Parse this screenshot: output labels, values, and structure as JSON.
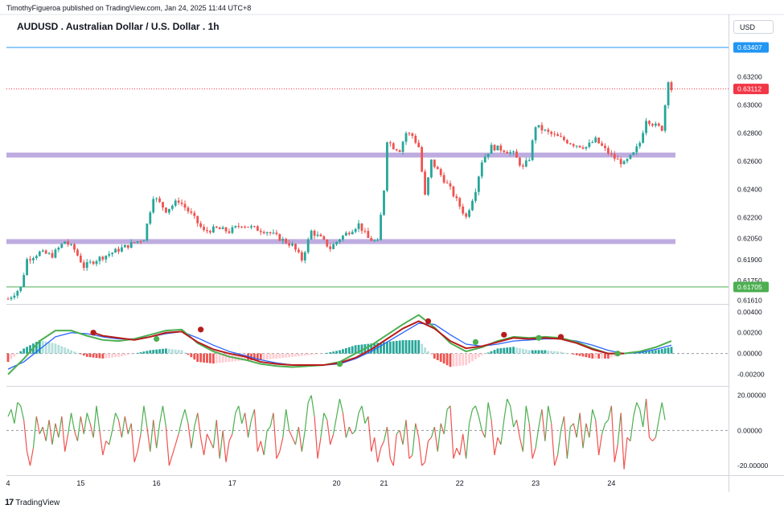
{
  "header": {
    "publisher": "TimothyFigueroa published on TradingView.com, Jan 24, 2025 11:44 UTC+8",
    "title": "AUDUSD . Australian Dollar / U.S. Dollar . 1h",
    "currency": "USD"
  },
  "footer": {
    "logo": "17",
    "brand": "TradingView"
  },
  "colors": {
    "up": "#26a69a",
    "down": "#ef5350",
    "zone": "#b39ddb",
    "blue_line": "#2196f3",
    "green_line": "#4caf50",
    "last_price": "#f23645",
    "macd_fast": "#4caf50",
    "macd_signal": "#2962ff",
    "macd_dark": "#b71c1c",
    "osc_up": "#4caf50",
    "osc_down": "#ef5350"
  },
  "chart_data": [
    {
      "type": "candlestick",
      "title": "AUDUSD . Australian Dollar / U.S. Dollar . 1h",
      "y_ticks": [
        "0.63200",
        "0.63000",
        "0.62800",
        "0.62600",
        "0.62400",
        "0.62200",
        "0.62050",
        "0.61900",
        "0.61750",
        "0.61610"
      ],
      "ylim": [
        0.6159,
        0.6347
      ],
      "x_ticks": [
        "4",
        "15",
        "16",
        "17",
        "20",
        "21",
        "22",
        "23",
        "24"
      ],
      "price_tags": [
        {
          "label": "0.63407",
          "value": 0.63407,
          "color": "#2196f3"
        },
        {
          "label": "0.63112",
          "value": 0.63112,
          "color": "#f23645"
        },
        {
          "label": "0.61705",
          "value": 0.61705,
          "color": "#4caf50"
        }
      ],
      "zones": [
        {
          "from": 0.62625,
          "to": 0.6266
        },
        {
          "from": 0.6201,
          "to": 0.62045
        }
      ],
      "close_path": [
        [
          0,
          0.6162
        ],
        [
          4,
          0.617
        ],
        [
          6,
          0.619
        ],
        [
          10,
          0.6195
        ],
        [
          14,
          0.6193
        ],
        [
          18,
          0.6203
        ],
        [
          21,
          0.6197
        ],
        [
          24,
          0.6185
        ],
        [
          28,
          0.619
        ],
        [
          33,
          0.6195
        ],
        [
          38,
          0.62
        ],
        [
          43,
          0.6205
        ],
        [
          46,
          0.6235
        ],
        [
          50,
          0.6225
        ],
        [
          54,
          0.6232
        ],
        [
          58,
          0.6222
        ],
        [
          62,
          0.621
        ],
        [
          66,
          0.6212
        ],
        [
          70,
          0.621
        ],
        [
          74,
          0.6215
        ],
        [
          78,
          0.6212
        ],
        [
          82,
          0.621
        ],
        [
          86,
          0.6205
        ],
        [
          90,
          0.62
        ],
        [
          93,
          0.619
        ],
        [
          96,
          0.621
        ],
        [
          99,
          0.6205
        ],
        [
          102,
          0.6198
        ],
        [
          105,
          0.6205
        ],
        [
          108,
          0.621
        ],
        [
          111,
          0.6215
        ],
        [
          114,
          0.6205
        ],
        [
          117,
          0.6202
        ],
        [
          119,
          0.624
        ],
        [
          120,
          0.6275
        ],
        [
          122,
          0.627
        ],
        [
          124,
          0.6268
        ],
        [
          126,
          0.628
        ],
        [
          128,
          0.6278
        ],
        [
          130,
          0.627
        ],
        [
          132,
          0.6235
        ],
        [
          134,
          0.626
        ],
        [
          137,
          0.625
        ],
        [
          140,
          0.624
        ],
        [
          142,
          0.6232
        ],
        [
          145,
          0.622
        ],
        [
          148,
          0.624
        ],
        [
          150,
          0.626
        ],
        [
          153,
          0.627
        ],
        [
          157,
          0.6268
        ],
        [
          160,
          0.6265
        ],
        [
          163,
          0.6255
        ],
        [
          165,
          0.6262
        ],
        [
          167,
          0.6285
        ],
        [
          171,
          0.628
        ],
        [
          175,
          0.6276
        ],
        [
          179,
          0.6272
        ],
        [
          183,
          0.627
        ],
        [
          186,
          0.6275
        ],
        [
          189,
          0.6268
        ],
        [
          192,
          0.6262
        ],
        [
          195,
          0.6258
        ],
        [
          198,
          0.6265
        ],
        [
          200,
          0.6273
        ],
        [
          202,
          0.629
        ],
        [
          205,
          0.6285
        ],
        [
          207,
          0.6283
        ],
        [
          208,
          0.63
        ],
        [
          209,
          0.6318
        ],
        [
          210,
          0.6311
        ]
      ]
    },
    {
      "type": "line",
      "name": "MACD panel",
      "y_ticks": [
        "0.00400",
        "0.00200",
        "0.00000",
        "-0.00200"
      ],
      "ylim": [
        -0.0028,
        0.0046
      ],
      "series": [
        {
          "key": "green",
          "x": [
            0,
            5,
            10,
            15,
            20,
            25,
            30,
            35,
            40,
            45,
            50,
            55,
            60,
            65,
            70,
            75,
            80,
            85,
            90,
            95,
            100,
            105,
            110,
            115,
            120,
            125,
            130,
            135,
            140,
            145,
            150,
            155,
            160,
            165,
            170,
            175,
            180,
            185,
            190,
            195,
            200,
            205,
            210
          ],
          "values": [
            -0.002,
            -0.0005,
            0.0012,
            0.0022,
            0.0022,
            0.0017,
            0.0013,
            0.0012,
            0.0014,
            0.0018,
            0.0022,
            0.0023,
            0.001,
            0.0002,
            -0.0003,
            -0.0006,
            -0.001,
            -0.0012,
            -0.0013,
            -0.0012,
            -0.0011,
            -0.0008,
            0.0,
            0.0008,
            0.0018,
            0.0028,
            0.0037,
            0.0025,
            0.001,
            0.0002,
            0.0006,
            0.0012,
            0.0016,
            0.0015,
            0.0016,
            0.0015,
            0.0011,
            0.0005,
            0.0,
            0.0,
            0.0002,
            0.0006,
            0.0012
          ]
        },
        {
          "key": "blue",
          "x": [
            0,
            5,
            10,
            15,
            20,
            25,
            30,
            35,
            40,
            45,
            50,
            55,
            60,
            65,
            70,
            75,
            80,
            85,
            90,
            95,
            100,
            105,
            110,
            115,
            120,
            125,
            130,
            135,
            140,
            145,
            150,
            155,
            160,
            165,
            170,
            175,
            180,
            185,
            190,
            195,
            200,
            205,
            210
          ],
          "values": [
            -0.0015,
            -0.0008,
            0.0004,
            0.0016,
            0.002,
            0.0019,
            0.0016,
            0.0014,
            0.0014,
            0.0016,
            0.0019,
            0.0021,
            0.0015,
            0.0008,
            0.0002,
            -0.0002,
            -0.0006,
            -0.0009,
            -0.0011,
            -0.0011,
            -0.0011,
            -0.001,
            -0.0005,
            0.0002,
            0.0011,
            0.002,
            0.0029,
            0.0028,
            0.0018,
            0.0009,
            0.0007,
            0.0009,
            0.0012,
            0.0013,
            0.0014,
            0.0014,
            0.0012,
            0.0008,
            0.0003,
            0.0,
            0.0001,
            0.0004,
            0.0008
          ]
        },
        {
          "key": "dark",
          "x": [
            27,
            30,
            35,
            40,
            45,
            50,
            55,
            60,
            65,
            70,
            75,
            80,
            85,
            90,
            95,
            100,
            105,
            110,
            115,
            120,
            125,
            130,
            135,
            140,
            145,
            150,
            155,
            160,
            165,
            170,
            175,
            180,
            185,
            190,
            195
          ],
          "values": [
            0.002,
            0.0017,
            0.0015,
            0.0013,
            0.0016,
            0.002,
            0.0021,
            0.0011,
            0.0004,
            0.0,
            -0.0003,
            -0.0008,
            -0.001,
            -0.0011,
            -0.0011,
            -0.0011,
            -0.0009,
            -0.0004,
            0.0004,
            0.0014,
            0.0024,
            0.0031,
            0.0024,
            0.0012,
            0.0005,
            0.0007,
            0.0011,
            0.0015,
            0.0014,
            0.0015,
            0.0014,
            0.001,
            0.0004,
            0.0,
            0.0
          ]
        }
      ],
      "markers": [
        {
          "x": 27,
          "value": 0.002,
          "color": "#b71c1c"
        },
        {
          "x": 47,
          "value": 0.0014,
          "color": "#4caf50"
        },
        {
          "x": 61,
          "value": 0.0023,
          "color": "#b71c1c"
        },
        {
          "x": 105,
          "value": -0.001,
          "color": "#4caf50"
        },
        {
          "x": 133,
          "value": 0.0031,
          "color": "#b71c1c"
        },
        {
          "x": 148,
          "value": 0.0011,
          "color": "#4caf50"
        },
        {
          "x": 157,
          "value": 0.0018,
          "color": "#b71c1c"
        },
        {
          "x": 168,
          "value": 0.0015,
          "color": "#4caf50"
        },
        {
          "x": 175,
          "value": 0.0016,
          "color": "#b71c1c"
        },
        {
          "x": 193,
          "value": 0.0,
          "color": "#4caf50"
        }
      ]
    },
    {
      "type": "line",
      "name": "Oscillator panel",
      "y_ticks": [
        "20.00000",
        "0.00000",
        "-20.00000"
      ],
      "ylim": [
        -25,
        24
      ],
      "values": [
        8,
        12,
        4,
        16,
        14,
        6,
        -12,
        -20,
        -10,
        8,
        -2,
        2,
        -6,
        6,
        -8,
        4,
        -4,
        8,
        -12,
        -2,
        10,
        0,
        -6,
        8,
        -2,
        10,
        4,
        -4,
        14,
        0,
        -14,
        -6,
        -8,
        0,
        10,
        6,
        -4,
        8,
        -2,
        4,
        -18,
        -12,
        -2,
        14,
        2,
        -12,
        6,
        -10,
        4,
        14,
        2,
        -20,
        -14,
        -8,
        -2,
        6,
        12,
        4,
        -10,
        2,
        10,
        -4,
        -14,
        -2,
        -6,
        -10,
        6,
        -16,
        0,
        -18,
        -6,
        -2,
        10,
        14,
        4,
        10,
        -4,
        6,
        12,
        -12,
        -6,
        -14,
        0,
        2,
        10,
        -16,
        -12,
        -4,
        12,
        0,
        -4,
        -8,
        2,
        -12,
        0,
        16,
        20,
        8,
        -16,
        -4,
        10,
        6,
        -8,
        -2,
        8,
        18,
        10,
        -4,
        2,
        -2,
        0,
        10,
        14,
        4,
        8,
        -12,
        -4,
        -18,
        -10,
        -6,
        2,
        -16,
        -20,
        -2,
        0,
        -8,
        6,
        -16,
        -14,
        4,
        -4,
        -20,
        -18,
        -6,
        -4,
        2,
        -12,
        4,
        -2,
        12,
        14,
        -16,
        -10,
        -14,
        -2,
        -16,
        4,
        12,
        14,
        8,
        0,
        -4,
        16,
        6,
        -14,
        -4,
        -8,
        6,
        18,
        14,
        2,
        6,
        -4,
        -12,
        14,
        4,
        -16,
        -10,
        2,
        12,
        -6,
        14,
        4,
        -20,
        -14,
        0,
        8,
        -16,
        2,
        4,
        -4,
        10,
        -10,
        4,
        -4,
        12,
        6,
        -14,
        -2,
        4,
        6,
        14,
        -18,
        -8,
        10,
        -22,
        -4,
        -6,
        8,
        16,
        12,
        2,
        18,
        -4,
        -6,
        -4,
        6,
        16,
        6
      ]
    }
  ]
}
